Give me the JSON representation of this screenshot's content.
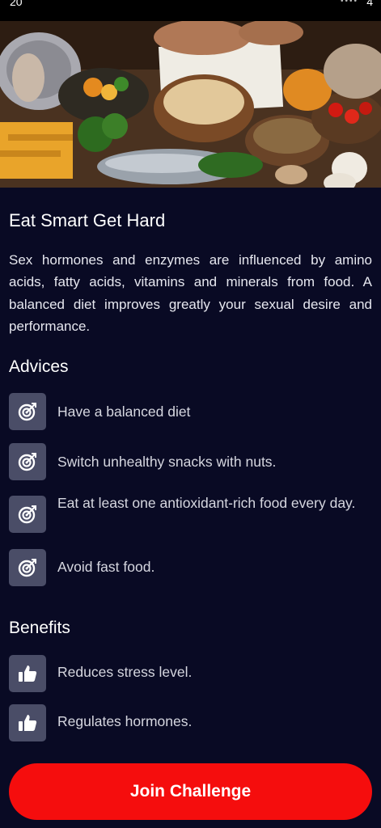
{
  "status_bar": {
    "time": "20",
    "right": "4"
  },
  "hero": {
    "image": "healthy food spread with fish, fries, nuts, vegetables and a notebook"
  },
  "title": "Eat Smart Get Hard",
  "intro": "Sex hormones and enzymes are influenced by amino acids, fatty acids, vitamins and minerals from food. A balanced diet improves greatly your sexual desire and performance.",
  "advices": {
    "heading": "Advices",
    "icon": "target-icon",
    "items": [
      {
        "text": "Have a balanced diet"
      },
      {
        "text": "Switch unhealthy snacks with nuts."
      },
      {
        "text": "Eat at least one antioxidant-rich food every day."
      },
      {
        "text": "Avoid fast food."
      }
    ]
  },
  "benefits": {
    "heading": "Benefits",
    "icon": "thumbs-up-icon",
    "items": [
      {
        "text": "Reduces stress level."
      },
      {
        "text": "Regulates hormones."
      }
    ]
  },
  "join_button": {
    "label": "Join Challenge"
  },
  "colors": {
    "background": "#090a24",
    "icon_box": "#4a4d67",
    "button": "#f50d0d",
    "text": "#ffffff"
  }
}
